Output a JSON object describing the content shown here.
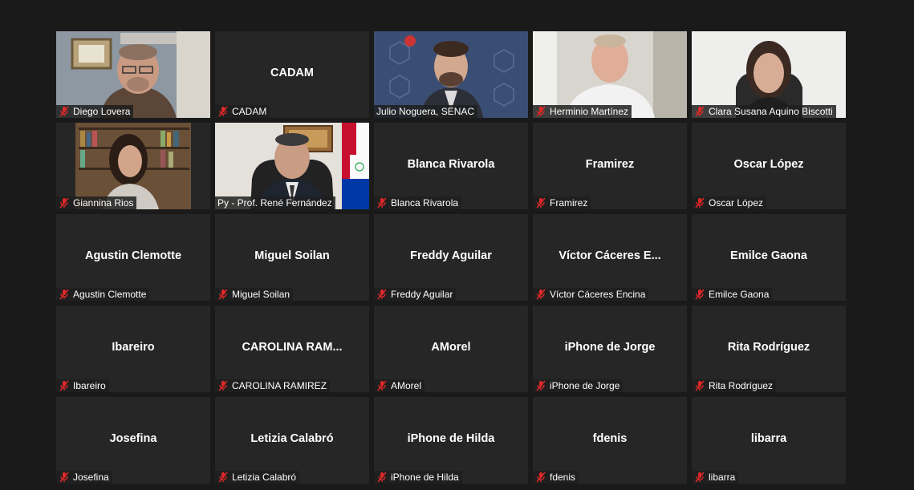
{
  "colors": {
    "background": "#1a1a1a",
    "tile": "#262626",
    "active_border": "#d6e14a",
    "muted_icon": "#e02828"
  },
  "participants": [
    {
      "id": "diego",
      "label": "Diego Lovera",
      "video": true
    },
    {
      "id": "cadam",
      "label": "CADAM",
      "center": "CADAM"
    },
    {
      "id": "julio",
      "label": "Julio Noguera, SENAC",
      "video": true,
      "mic_icon": false
    },
    {
      "id": "herminio",
      "label": "Herminio Martínez",
      "video": true
    },
    {
      "id": "clara",
      "label": "Clara Susana Aquino Biscotti",
      "video": true
    },
    {
      "id": "giannina",
      "label": "Giannina Rios",
      "video": true
    },
    {
      "id": "rene",
      "label": "Py - Prof. René Fernández",
      "video": true,
      "active": true,
      "mic_icon": false
    },
    {
      "id": "blanca",
      "label": "Blanca Rivarola",
      "center": "Blanca Rivarola"
    },
    {
      "id": "framirez",
      "label": "Framirez",
      "center": "Framirez"
    },
    {
      "id": "oscar",
      "label": "Oscar López",
      "center": "Oscar López"
    },
    {
      "id": "agustin",
      "label": "Agustin Clemotte",
      "center": "Agustin Clemotte"
    },
    {
      "id": "miguel",
      "label": "Miguel Soilan",
      "center": "Miguel Soilan"
    },
    {
      "id": "freddy",
      "label": "Freddy Aguilar",
      "center": "Freddy Aguilar"
    },
    {
      "id": "victor",
      "label": "Víctor Cáceres Encina",
      "center": "Víctor Cáceres E..."
    },
    {
      "id": "emilce",
      "label": "Emilce Gaona",
      "center": "Emilce Gaona"
    },
    {
      "id": "ibareiro",
      "label": "Ibareiro",
      "center": "Ibareiro"
    },
    {
      "id": "carolina",
      "label": "CAROLINA RAMIREZ",
      "center": "CAROLINA RAM..."
    },
    {
      "id": "amorel",
      "label": "AMorel",
      "center": "AMorel"
    },
    {
      "id": "iphone-jorge",
      "label": "iPhone de Jorge",
      "center": "iPhone de Jorge"
    },
    {
      "id": "rita",
      "label": "Rita Rodríguez",
      "center": "Rita Rodríguez"
    },
    {
      "id": "josefina",
      "label": "Josefina",
      "center": "Josefina"
    },
    {
      "id": "letizia",
      "label": "Letizia Calabró",
      "center": "Letizia Calabró"
    },
    {
      "id": "iphone-hilda",
      "label": "iPhone de Hilda",
      "center": "iPhone de Hilda"
    },
    {
      "id": "fdenis",
      "label": "fdenis",
      "center": "fdenis"
    },
    {
      "id": "libarra",
      "label": "libarra",
      "center": "libarra"
    }
  ]
}
